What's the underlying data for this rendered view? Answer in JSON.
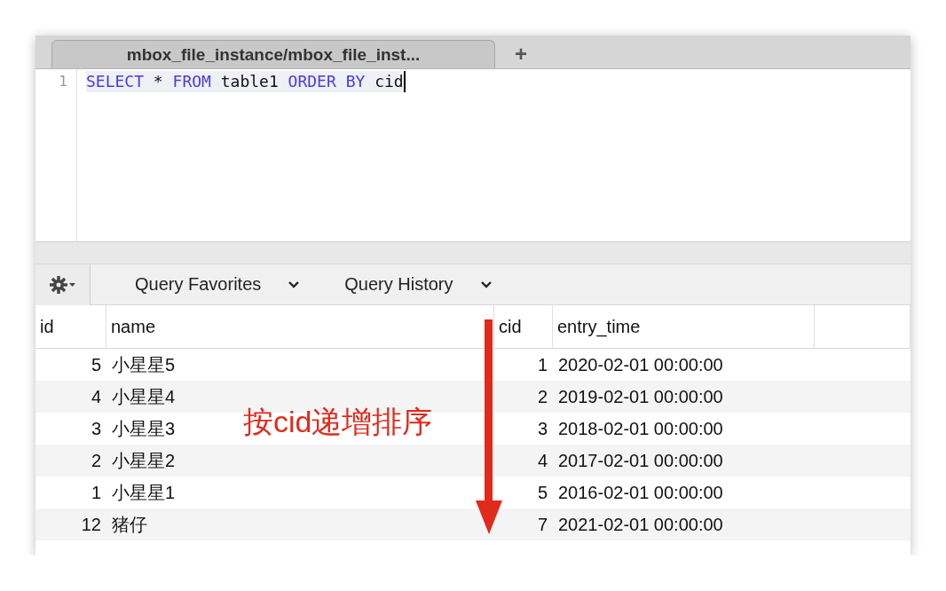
{
  "tabs": [
    {
      "label": "mbox_file_instance/mbox_file_inst..."
    }
  ],
  "add_tab": "+",
  "editor": {
    "lines": [
      {
        "number": "1",
        "tokens": [
          {
            "kind": "keyword",
            "text": "SELECT"
          },
          {
            "kind": "plain",
            "text": " * "
          },
          {
            "kind": "keyword",
            "text": "FROM"
          },
          {
            "kind": "plain",
            "text": " table1 "
          },
          {
            "kind": "keyword",
            "text": "ORDER BY"
          },
          {
            "kind": "plain",
            "text": " cid"
          }
        ]
      }
    ]
  },
  "toolbar": {
    "menus": [
      {
        "label": "Query Favorites"
      },
      {
        "label": "Query History"
      }
    ]
  },
  "table": {
    "columns": [
      "id",
      "name",
      "cid",
      "entry_time"
    ],
    "rows": [
      [
        "5",
        "小星星5",
        "1",
        "2020-02-01 00:00:00"
      ],
      [
        "4",
        "小星星4",
        "2",
        "2019-02-01 00:00:00"
      ],
      [
        "3",
        "小星星3",
        "3",
        "2018-02-01 00:00:00"
      ],
      [
        "2",
        "小星星2",
        "4",
        "2017-02-01 00:00:00"
      ],
      [
        "1",
        "小星星1",
        "5",
        "2016-02-01 00:00:00"
      ],
      [
        "12",
        "猪仔",
        "7",
        "2021-02-01 00:00:00"
      ]
    ]
  },
  "annotation": {
    "text": "按cid递增排序"
  }
}
